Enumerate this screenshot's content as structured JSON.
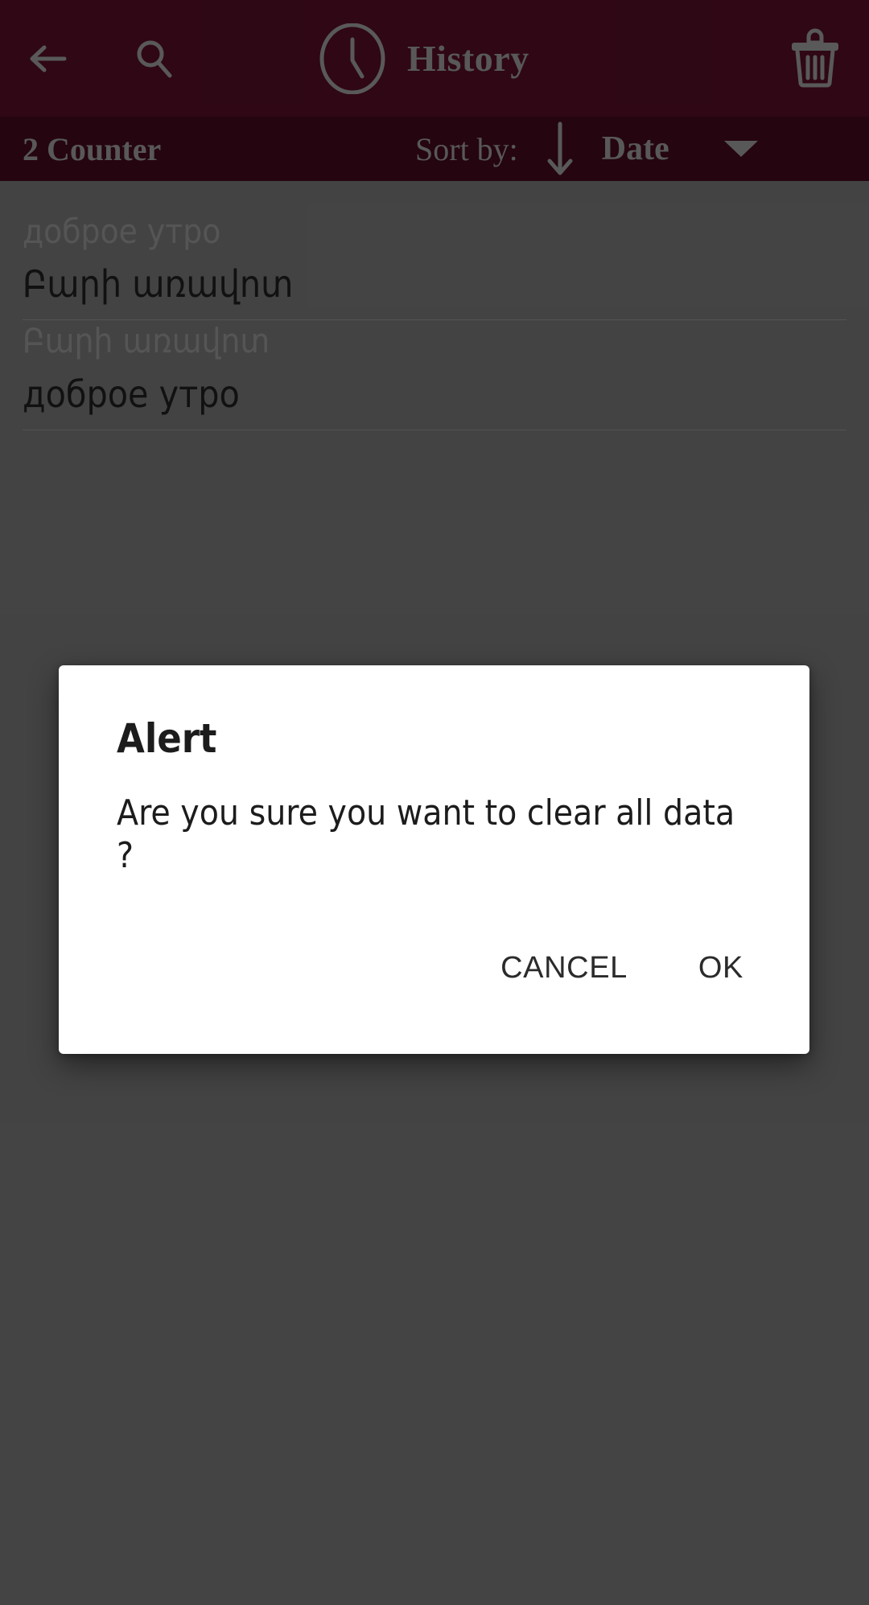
{
  "colors": {
    "app_bar": "#4a0c22",
    "sub_bar": "#3b0819",
    "icon_tint": "#8c8c8c",
    "list_background": "#6a6a6a",
    "dialog_background": "#ffffff",
    "source_text": "#868686",
    "target_text": "#1b1b1b"
  },
  "top_bar": {
    "title": "History",
    "back_icon": "arrow-left-icon",
    "search_icon": "search-icon",
    "history_icon": "clock-icon",
    "delete_icon": "trash-icon"
  },
  "sub_bar": {
    "counter": "2 Counter",
    "sort_by_label": "Sort by:",
    "sort_direction_icon": "arrow-down-icon",
    "sort_value": "Date",
    "dropdown_icon": "caret-down-icon"
  },
  "history": {
    "items": [
      {
        "source": "доброе утро",
        "target": "Բարի առավոտ"
      },
      {
        "source": "Բարի առավոտ",
        "target": "доброе утро"
      }
    ]
  },
  "dialog": {
    "title": "Alert",
    "message": "Are you sure you want to clear all data ?",
    "cancel_label": "CANCEL",
    "ok_label": "OK"
  }
}
